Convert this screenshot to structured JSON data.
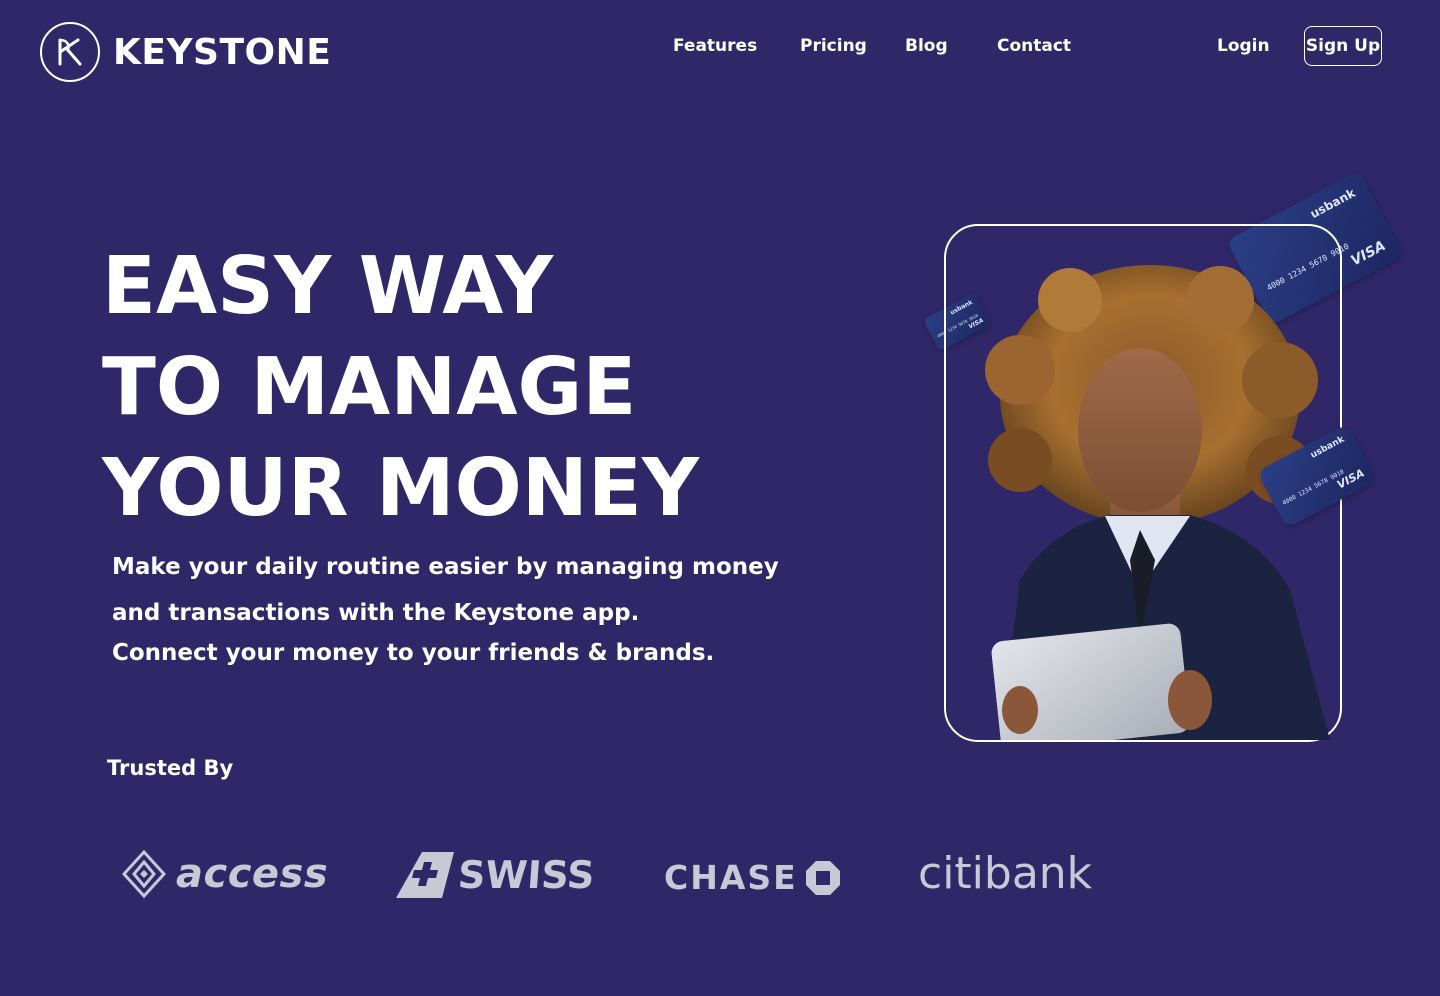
{
  "header": {
    "brand": "KEYSTONE",
    "nav": {
      "features": "Features",
      "pricing": "Pricing",
      "blog": "Blog",
      "contact": "Contact"
    },
    "login": "Login",
    "signup": "Sign Up"
  },
  "hero": {
    "headline": [
      "EASY WAY",
      "TO MANAGE",
      "YOUR MONEY"
    ],
    "subtext": [
      "Make your daily routine easier by managing money",
      "and transactions with the Keystone app.",
      "Connect your  money to your friends & brands."
    ]
  },
  "cards": {
    "bank": "usbank",
    "number": "4000 1234 5678 9010",
    "network": "VISA"
  },
  "trusted": {
    "heading": "Trusted By",
    "brands": {
      "access": "access",
      "swiss": "SWISS",
      "chase": "CHASE",
      "citi": "citibank"
    }
  },
  "colors": {
    "background": "#2f2768",
    "text": "#ffffff",
    "brand_logo_gray": "#c9c9d6"
  },
  "icons": {
    "logo": "keystone-k-logo-icon",
    "access": "access-diamond-icon",
    "swiss": "swiss-cross-icon",
    "chase": "chase-octagon-icon"
  }
}
